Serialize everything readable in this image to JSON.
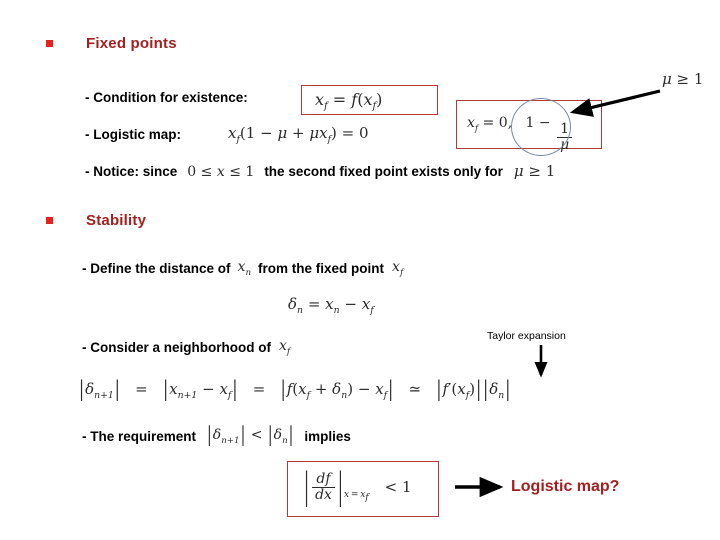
{
  "slide": {
    "sections": [
      {
        "id": "fixed-points",
        "title": "Fixed points",
        "bullet": "square-bullet"
      },
      {
        "id": "stability",
        "title": "Stability",
        "bullet": "square-bullet"
      }
    ],
    "items": {
      "condition_label": "-  Condition for existence:",
      "logistic_label": "-  Logistic map:",
      "notice_prefix": "-  Notice: since",
      "notice_middle": "the second fixed point exists only for",
      "define_prefix": "-  Define the distance of",
      "define_middle": "from the fixed point",
      "consider_prefix": "-  Consider a neighborhood of",
      "requirement_prefix": "- The requirement",
      "requirement_suffix": "implies",
      "taylor_note": "Taylor expansion",
      "logistic_question": "Logistic map?"
    },
    "equations": {
      "fixed_point_condition": "x_f = f(x_f)",
      "logistic_fixed_eq": "x_f(1 - μ + μ x_f) = 0",
      "fixed_point_solutions": "x_f = 0,  1 - 1/μ",
      "mu_condition_top": "μ ≥ 1",
      "mu_condition_inline": "μ ≥ 1",
      "x_range": "0 ≤ x ≤ 1",
      "x_n": "x_n",
      "x_f": "x_f",
      "delta_def": "δ_n = x_n - x_f",
      "taylor_chain": "|δ_{n+1}| = |x_{n+1} - x_f| = |f(x_f + δ_n) - x_f| ≃ |f'(x_f)||δ_n|",
      "requirement_ineq": "|δ_{n+1}| < |δ_n|",
      "stability_condition": "|df/dx|_{x=x_f} < 1"
    },
    "colors": {
      "heading_red": "#a32020",
      "bullet_red": "#e8201f",
      "box_border": "#b03a36",
      "circle_annot": "#7a8aa8",
      "arrow_black": "#000000",
      "text_black": "#000000"
    }
  }
}
